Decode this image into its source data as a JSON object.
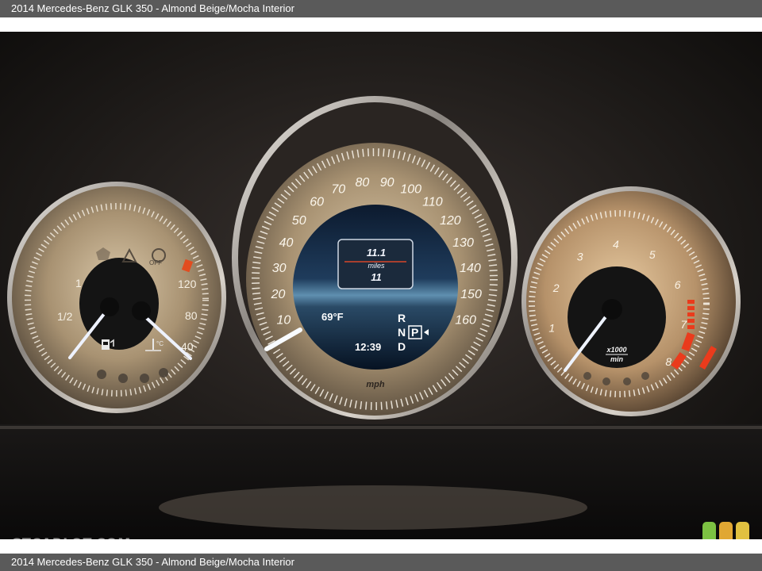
{
  "caption": {
    "title": "2014 Mercedes-Benz GLK 350 - Almond Beige/Mocha Interior"
  },
  "watermark": {
    "text": "GTCARLOT.COM"
  },
  "badge_colors": [
    "#7cc142",
    "#e0a733",
    "#e0c040"
  ],
  "cluster": {
    "speedometer": {
      "labels": [
        "10",
        "20",
        "30",
        "40",
        "50",
        "60",
        "70",
        "80",
        "90",
        "100",
        "110",
        "120",
        "130",
        "140",
        "150",
        "160"
      ],
      "unit": "mph",
      "display": {
        "trip_value": "11.1",
        "trip_unit": "miles",
        "trip_sub": "11",
        "outside_temp": "69°F",
        "clock": "12:39",
        "gears": [
          "R",
          "N",
          "P",
          "D"
        ],
        "selected_gear": "P"
      }
    },
    "left_gauge": {
      "fuel_labels": [
        "1",
        "1/2"
      ],
      "temp_labels": [
        "120",
        "80",
        "40"
      ],
      "fuel_icon": "fuel-pump-icon",
      "temp_icon": "coolant-temperature-icon"
    },
    "tachometer": {
      "labels": [
        "1",
        "2",
        "3",
        "4",
        "5",
        "6",
        "7",
        "8"
      ],
      "unit_multiplier": "x1000",
      "unit": "min"
    }
  }
}
